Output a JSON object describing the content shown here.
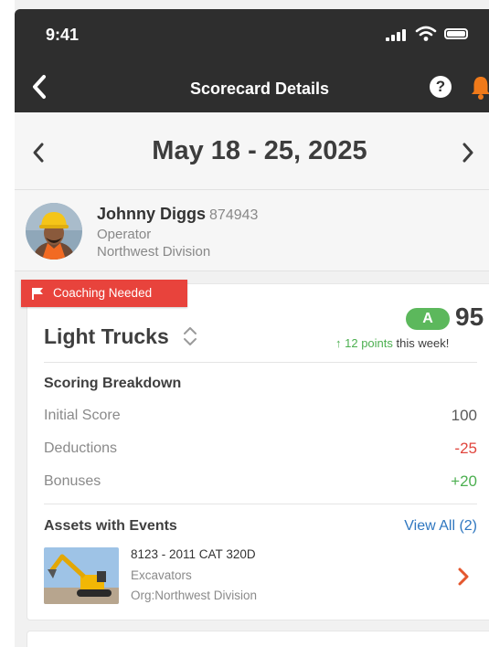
{
  "status": {
    "time": "9:41"
  },
  "nav": {
    "title": "Scorecard Details",
    "help_label": "?"
  },
  "date": {
    "range": "May 18 - 25, 2025"
  },
  "user": {
    "name": "Johnny Diggs",
    "id": "874943",
    "role": "Operator",
    "division": "Northwest Division"
  },
  "card": {
    "flag": "Coaching Needed",
    "title": "Light Trucks",
    "grade": "A",
    "score": "95",
    "trend_points": "12 points",
    "trend_suffix": "this week!",
    "breakdown_title": "Scoring Breakdown",
    "rows": [
      {
        "label": "Initial Score",
        "value": "100"
      },
      {
        "label": "Deductions",
        "value": "-25"
      },
      {
        "label": "Bonuses",
        "value": "+20"
      }
    ],
    "assets_title": "Assets with Events",
    "view_all": "View All (2)",
    "asset": {
      "name": "8123 - 2011 CAT 320D",
      "type": "Excavators",
      "org": "Org:Northwest Division"
    }
  },
  "colors": {
    "nav_bg": "#2e2e2e",
    "alert": "#e8433c",
    "grade": "#5cb85c",
    "positive": "#4caf50",
    "negative": "#e0453d",
    "link": "#2f77c0",
    "bell": "#f07a1a"
  }
}
